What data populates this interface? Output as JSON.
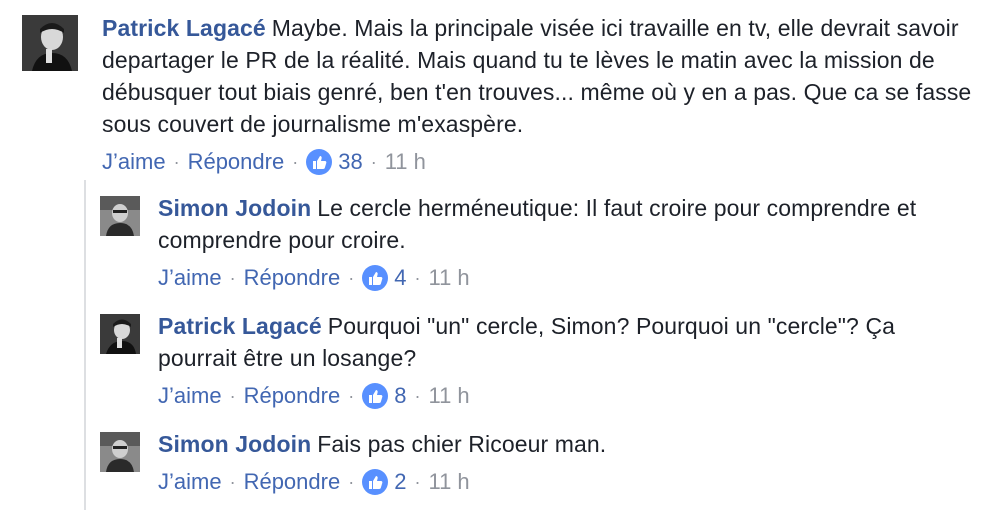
{
  "comments": [
    {
      "author": "Patrick Lagacé",
      "text": "Maybe. Mais la principale visée ici travaille en tv, elle devrait savoir departager le PR de la réalité. Mais quand tu te lèves le matin avec la mission de débusquer tout biais genré, ben t'en trouves... même où y en a pas. Que ca se fasse sous couvert de journalisme m'exaspère.",
      "like_label": "J’aime",
      "reply_label": "Répondre",
      "likes": "38",
      "time": "11 h",
      "avatar": "patrick-avatar"
    },
    {
      "author": "Simon Jodoin",
      "text": "Le cercle herméneutique: Il faut croire pour comprendre et comprendre pour croire.",
      "like_label": "J’aime",
      "reply_label": "Répondre",
      "likes": "4",
      "time": "11 h",
      "avatar": "simon-avatar"
    },
    {
      "author": "Patrick Lagacé",
      "text": "Pourquoi \"un\" cercle, Simon? Pourquoi un \"cercle\"? Ça pourrait être un losange?",
      "like_label": "J’aime",
      "reply_label": "Répondre",
      "likes": "8",
      "time": "11 h",
      "avatar": "patrick-avatar"
    },
    {
      "author": "Simon Jodoin",
      "text": "Fais pas chier Ricoeur man.",
      "like_label": "J’aime",
      "reply_label": "Répondre",
      "likes": "2",
      "time": "11 h",
      "avatar": "simon-avatar"
    }
  ],
  "colors": {
    "author": "#365899",
    "action_link": "#4267b2",
    "meta": "#90949c",
    "like_badge": "#5890ff",
    "thread_line": "#dddfe2"
  }
}
